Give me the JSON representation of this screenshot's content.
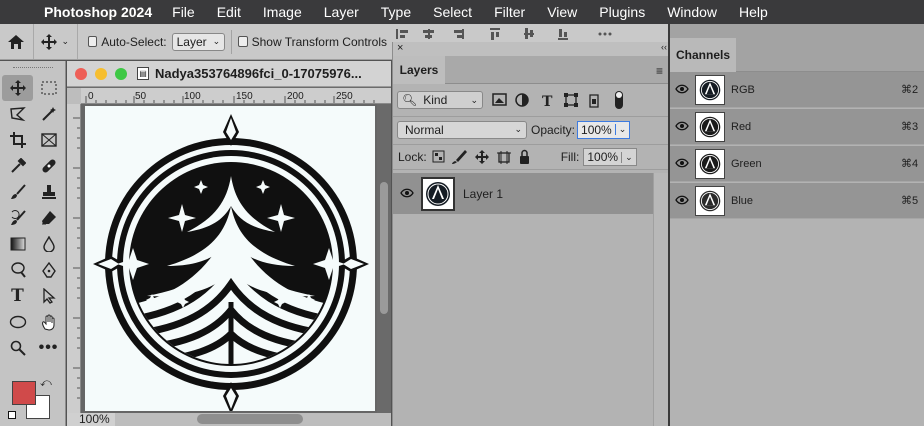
{
  "menubar": {
    "app_name": "Photoshop 2024",
    "items": [
      "File",
      "Edit",
      "Image",
      "Layer",
      "Type",
      "Select",
      "Filter",
      "View",
      "Plugins",
      "Window",
      "Help"
    ]
  },
  "options_bar": {
    "auto_select_label": "Auto-Select:",
    "auto_select_value": "Layer",
    "show_transform_label": "Show Transform Controls"
  },
  "document": {
    "title": "Nadya353764896fci_0-17075976...",
    "zoom": "100%",
    "ruler_ticks": [
      "0",
      "50",
      "100",
      "150",
      "200",
      "250"
    ]
  },
  "layers_panel": {
    "tab_label": "Layers",
    "filter_kind": "Kind",
    "blend_mode": "Normal",
    "opacity_label": "Opacity:",
    "opacity_value": "100%",
    "lock_label": "Lock:",
    "fill_label": "Fill:",
    "fill_value": "100%",
    "layers": [
      {
        "name": "Layer 1",
        "visible": true,
        "selected": true
      }
    ]
  },
  "channels_panel": {
    "tab_label": "Channels",
    "channels": [
      {
        "name": "RGB",
        "shortcut": "⌘2"
      },
      {
        "name": "Red",
        "shortcut": "⌘3"
      },
      {
        "name": "Green",
        "shortcut": "⌘4"
      },
      {
        "name": "Blue",
        "shortcut": "⌘5"
      }
    ]
  },
  "colors": {
    "foreground": "#d04a4a",
    "background": "#ffffff",
    "accent_focus": "#3d7be0"
  }
}
